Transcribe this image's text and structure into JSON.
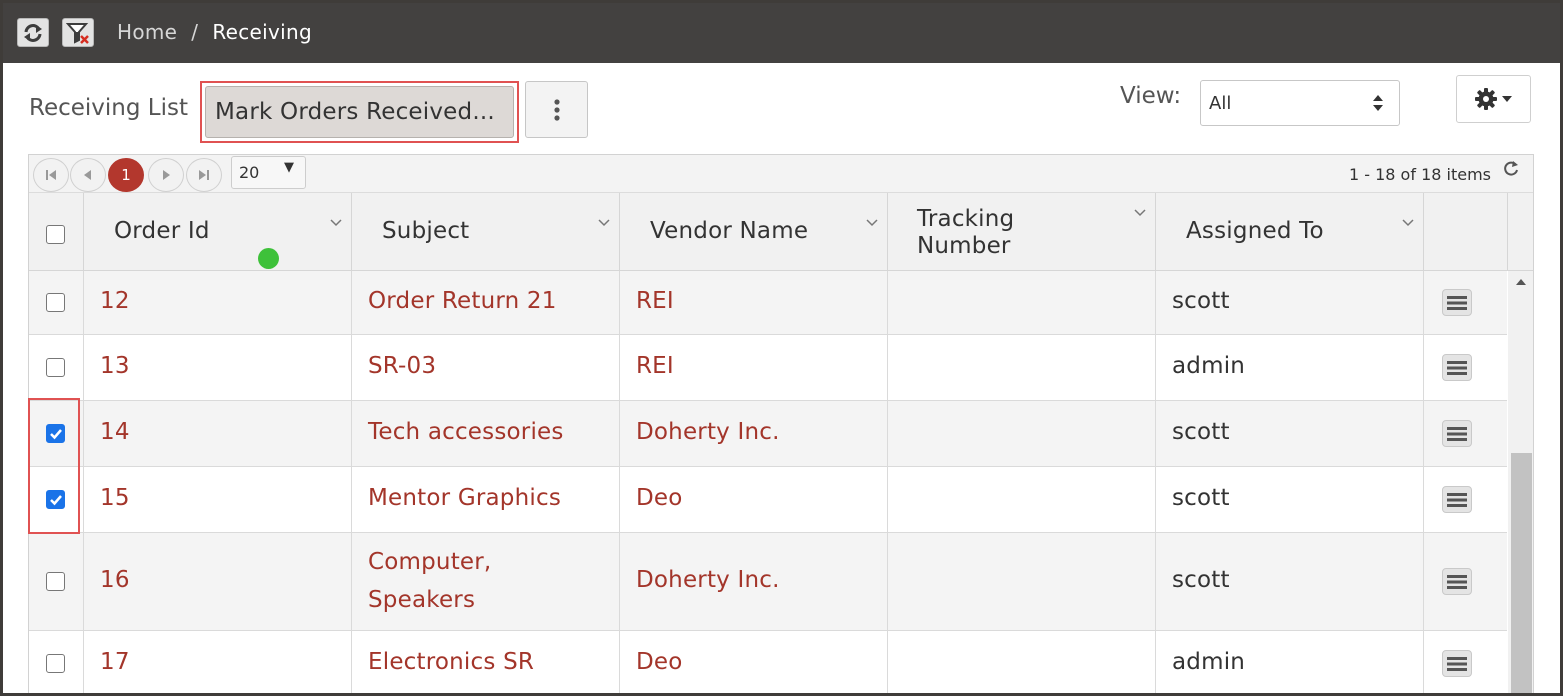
{
  "breadcrumb": {
    "home": "Home",
    "separator": "/",
    "current": "Receiving"
  },
  "toolbar": {
    "list_title": "Receiving List",
    "mark_button_label": "Mark Orders Received...",
    "view_label": "View:",
    "view_selected": "All"
  },
  "pager": {
    "current_page": "1",
    "page_size": "20",
    "info": "1 - 18 of 18 items"
  },
  "columns": {
    "order_id": "Order Id",
    "subject": "Subject",
    "vendor_name": "Vendor Name",
    "tracking_line1": "Tracking",
    "tracking_line2": "Number",
    "assigned_to": "Assigned To"
  },
  "rows": [
    {
      "order_id": "12",
      "subject": "Order Return 21",
      "subject2": "",
      "vendor": "REI",
      "tracking": "",
      "assigned": "scott",
      "checked": false
    },
    {
      "order_id": "13",
      "subject": "SR-03",
      "subject2": "",
      "vendor": "REI",
      "tracking": "",
      "assigned": "admin",
      "checked": false
    },
    {
      "order_id": "14",
      "subject": "Tech accessories",
      "subject2": "",
      "vendor": "Doherty Inc.",
      "tracking": "",
      "assigned": "scott",
      "checked": true
    },
    {
      "order_id": "15",
      "subject": "Mentor Graphics",
      "subject2": "",
      "vendor": "Deo",
      "tracking": "",
      "assigned": "scott",
      "checked": true
    },
    {
      "order_id": "16",
      "subject": "Computer,",
      "subject2": "Speakers",
      "vendor": "Doherty Inc.",
      "tracking": "",
      "assigned": "scott",
      "checked": false
    },
    {
      "order_id": "17",
      "subject": "Electronics SR",
      "subject2": "",
      "vendor": "Deo",
      "tracking": "",
      "assigned": "admin",
      "checked": false
    }
  ],
  "colors": {
    "link": "#a3352a",
    "current_page": "#b3372d",
    "checkbox_checked": "#1a73e8",
    "highlight": "#e05252",
    "status_dot": "#3ec13a"
  },
  "icons": {
    "refresh": "refresh-icon",
    "clear_filter": "clear-filter-icon",
    "more": "vertical-ellipsis-icon",
    "gear": "gear-icon",
    "row_menu": "hamburger-menu-icon"
  }
}
